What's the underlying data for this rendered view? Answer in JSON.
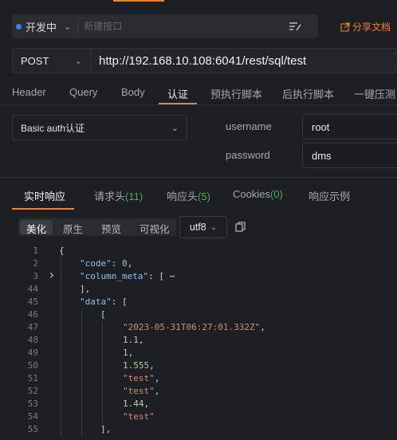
{
  "env": {
    "label": "开发中",
    "api_placeholder": "新建接口",
    "share_label": "分享文档"
  },
  "request": {
    "method": "POST",
    "url": "http://192.168.10.108:6041/rest/sql/test"
  },
  "request_tabs": [
    "Header",
    "Query",
    "Body",
    "认证",
    "预执行脚本",
    "后执行脚本",
    "一键压测"
  ],
  "auth": {
    "type_label": "Basic auth认证",
    "username_label": "username",
    "username_value": "root",
    "password_label": "password",
    "password_value": "dms"
  },
  "response_tabs": {
    "realtime": "实时响应",
    "req_headers": "请求头",
    "req_headers_count": "(11)",
    "resp_headers": "响应头",
    "resp_headers_count": "(5)",
    "cookies": "Cookies",
    "cookies_count": "(0)",
    "example": "响应示例"
  },
  "view_modes": [
    "美化",
    "原生",
    "预览",
    "可视化"
  ],
  "encoding": "utf8",
  "code_lines": [
    {
      "n": "1",
      "indent": 0,
      "tokens": [
        [
          "p",
          "{"
        ]
      ]
    },
    {
      "n": "2",
      "indent": 1,
      "tokens": [
        [
          "k",
          "\"code\""
        ],
        [
          "p",
          ": "
        ],
        [
          "n",
          "0"
        ],
        [
          "p",
          ","
        ]
      ]
    },
    {
      "n": "3",
      "indent": 1,
      "fold": true,
      "tokens": [
        [
          "k",
          "\"column_meta\""
        ],
        [
          "p",
          ": [ ⋯"
        ]
      ]
    },
    {
      "n": "44",
      "indent": 1,
      "tokens": [
        [
          "p",
          "],"
        ]
      ]
    },
    {
      "n": "45",
      "indent": 1,
      "tokens": [
        [
          "k",
          "\"data\""
        ],
        [
          "p",
          ": ["
        ]
      ]
    },
    {
      "n": "46",
      "indent": 2,
      "tokens": [
        [
          "p",
          "["
        ]
      ]
    },
    {
      "n": "47",
      "indent": 3,
      "tokens": [
        [
          "s",
          "\"2023-05-31T06:27:01.332Z\""
        ],
        [
          "p",
          ","
        ]
      ]
    },
    {
      "n": "48",
      "indent": 3,
      "tokens": [
        [
          "n",
          "1.1"
        ],
        [
          "p",
          ","
        ]
      ]
    },
    {
      "n": "49",
      "indent": 3,
      "tokens": [
        [
          "n",
          "1"
        ],
        [
          "p",
          ","
        ]
      ]
    },
    {
      "n": "50",
      "indent": 3,
      "tokens": [
        [
          "n",
          "1.555"
        ],
        [
          "p",
          ","
        ]
      ]
    },
    {
      "n": "51",
      "indent": 3,
      "tokens": [
        [
          "s",
          "\"test\""
        ],
        [
          "p",
          ","
        ]
      ]
    },
    {
      "n": "52",
      "indent": 3,
      "tokens": [
        [
          "s",
          "\"test\""
        ],
        [
          "p",
          ","
        ]
      ]
    },
    {
      "n": "53",
      "indent": 3,
      "tokens": [
        [
          "n",
          "1.44"
        ],
        [
          "p",
          ","
        ]
      ]
    },
    {
      "n": "54",
      "indent": 3,
      "tokens": [
        [
          "s",
          "\"test\""
        ]
      ]
    },
    {
      "n": "55",
      "indent": 2,
      "tokens": [
        [
          "p",
          "],"
        ]
      ]
    }
  ],
  "colors": {
    "accent": "#e8833a",
    "env_dot": "#3b82f6",
    "count_green": "#4caf50"
  },
  "icons": [
    "chevron-down-icon",
    "format-icon",
    "share-icon",
    "copy-icon",
    "fold-arrow-icon"
  ]
}
